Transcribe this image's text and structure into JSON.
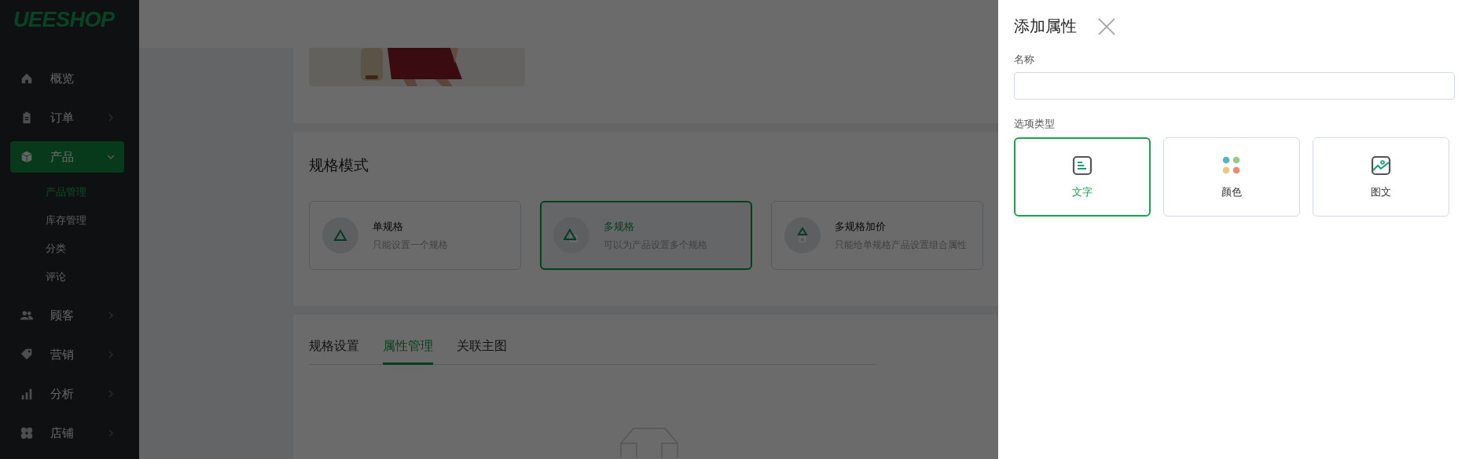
{
  "sidebar": {
    "logo": "UEESHOP",
    "items": [
      {
        "label": "概览",
        "kind": "link",
        "selected": false
      },
      {
        "label": "订单",
        "kind": "group",
        "expanded": false,
        "selected": false
      },
      {
        "label": "产品",
        "kind": "group",
        "expanded": true,
        "selected": true,
        "children": [
          {
            "label": "产品管理",
            "selected": true
          },
          {
            "label": "库存管理",
            "selected": false
          },
          {
            "label": "分类",
            "selected": false
          },
          {
            "label": "评论",
            "selected": false
          }
        ]
      },
      {
        "label": "顾客",
        "kind": "group",
        "expanded": false,
        "selected": false
      },
      {
        "label": "营销",
        "kind": "group",
        "expanded": false,
        "selected": false
      },
      {
        "label": "分析",
        "kind": "group",
        "expanded": false,
        "selected": false
      },
      {
        "label": "店铺",
        "kind": "group",
        "expanded": false,
        "selected": false
      }
    ]
  },
  "main": {
    "spec_mode": {
      "title": "规格模式",
      "options": [
        {
          "title": "单规格",
          "description": "只能设置一个规格",
          "selected": false
        },
        {
          "title": "多规格",
          "description": "可以为产品设置多个规格",
          "selected": true
        },
        {
          "title": "多规格加价",
          "description": "只能给单规格产品设置组合属性",
          "selected": false
        }
      ]
    },
    "tabs": [
      {
        "label": "规格设置",
        "selected": false
      },
      {
        "label": "属性管理",
        "selected": true
      },
      {
        "label": "关联主图",
        "selected": false
      }
    ]
  },
  "drawer": {
    "title": "添加属性",
    "name_field": {
      "label": "名称"
    },
    "option_type": {
      "label": "选项类型",
      "options": [
        {
          "label": "文字",
          "selected": true
        },
        {
          "label": "颜色",
          "selected": false
        },
        {
          "label": "图文",
          "selected": false
        }
      ]
    }
  }
}
